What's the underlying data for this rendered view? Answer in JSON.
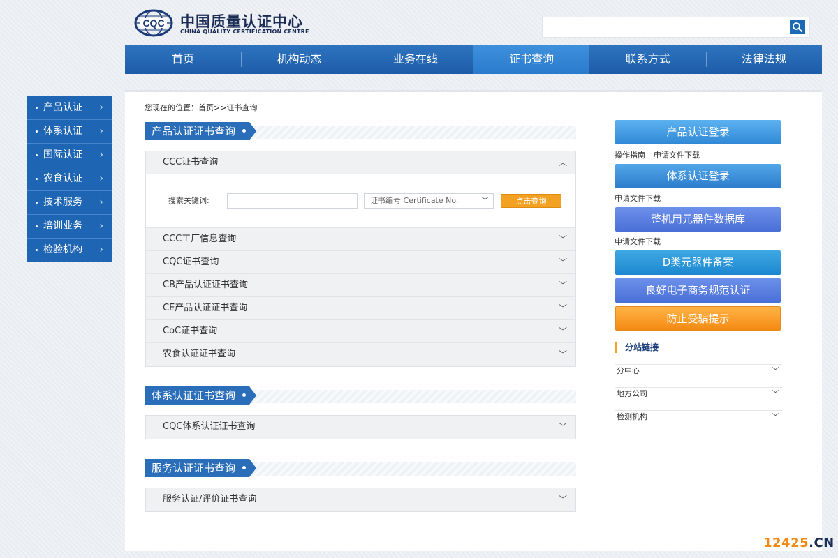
{
  "brand": {
    "cn": "中国质量认证中心",
    "en": "CHINA QUALITY CERTIFICATION CENTRE",
    "mark_text": "CQC"
  },
  "search": {
    "value": "",
    "placeholder": ""
  },
  "main_nav": [
    "首页",
    "机构动态",
    "业务在线",
    "证书查询",
    "联系方式",
    "法律法规"
  ],
  "main_nav_active": "证书查询",
  "sidebar": {
    "items": [
      {
        "label": "产品认证"
      },
      {
        "label": "体系认证"
      },
      {
        "label": "国际认证"
      },
      {
        "label": "农食认证"
      },
      {
        "label": "技术服务"
      },
      {
        "label": "培训业务"
      },
      {
        "label": "检验机构"
      }
    ]
  },
  "breadcrumb": "您现在的位置：首页>>证书查询",
  "sections": {
    "product": {
      "title": "产品认证证书查询",
      "open_item": {
        "title": "CCC证书查询",
        "keyword_label": "搜索关键词:",
        "keyword_value": "",
        "select_value": "证书编号 Certificate No.",
        "query_button": "点击查询"
      },
      "items": [
        "CCC工厂信息查询",
        "CQC证书查询",
        "CB产品认证证书查询",
        "CE产品认证证书查询",
        "CoC证书查询",
        "农食认证证书查询"
      ]
    },
    "system": {
      "title": "体系认证证书查询",
      "items": [
        "CQC体系认证证书查询"
      ]
    },
    "service": {
      "title": "服务认证证书查询",
      "items": [
        "服务认证/评价证书查询"
      ]
    }
  },
  "right": {
    "btn1": "产品认证登录",
    "links1": [
      "操作指南",
      "申请文件下载"
    ],
    "btn2": "体系认证登录",
    "links2": [
      "申请文件下载"
    ],
    "btn3": "整机用元器件数据库",
    "links3": [
      "申请文件下载"
    ],
    "btn4": "D类元器件备案",
    "btn5": "良好电子商务规范认证",
    "btn6": "防止受骗提示",
    "branch_title": "分站链接",
    "selects": [
      "分中心",
      "地方公司",
      "检测机构"
    ]
  },
  "watermark": {
    "num": "12425",
    "dot": ".CN"
  },
  "colors": {
    "nav_blue": "#1e66b4",
    "accent_orange": "#f2a123"
  }
}
